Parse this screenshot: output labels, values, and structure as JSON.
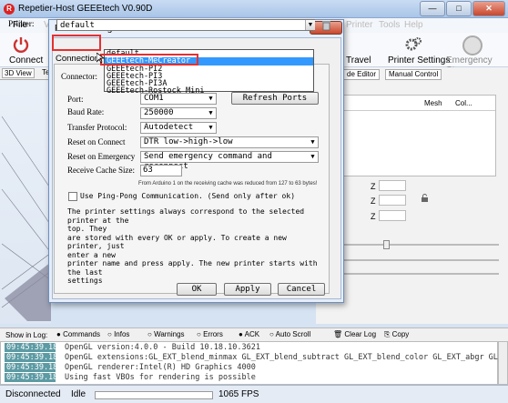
{
  "window": {
    "title": "Repetier-Host GEEEtech V0.90D",
    "icon": "R",
    "buttons": {
      "minimize": "—",
      "maximize": "□",
      "close": "✕"
    }
  },
  "menubar": [
    "File",
    "View",
    "Config",
    "Printer",
    "Tools",
    "Help"
  ],
  "toolbar": {
    "connect_label": "Connect",
    "travel_label": "Travel",
    "printer_settings_label": "Printer Settings",
    "emergency_stop_label": "Emergency Stop"
  },
  "left_tabs": [
    "3D View",
    "Te"
  ],
  "right_panel": {
    "tabs": [
      "de Editor",
      "Manual Control"
    ],
    "grid_headers": [
      "Mesh",
      "Col..."
    ],
    "z_label": "Z"
  },
  "dialog": {
    "title": "Printer Settings",
    "close": "✕",
    "printer_label": "Printer:",
    "printer_value": "default",
    "printer_options": [
      "default",
      "GEEEtech-MeCreator",
      "GEEEtech-PI2",
      "GEEEtech-PI3",
      "GEEEtech-PI3A",
      "GEEEtech-Rostock Mini"
    ],
    "selected_option_index": 1,
    "tab_connection": "Connection",
    "connector_label": "Connector:",
    "port_label": "Port:",
    "port_value": "COM1",
    "refresh_ports": "Refresh Ports",
    "baud_label": "Baud Rate:",
    "baud_value": "250000",
    "transfer_label": "Transfer Protocol:",
    "transfer_value": "Autodetect",
    "reset_connect_label": "Reset on Connect",
    "reset_connect_value": "DTR low->high->low",
    "reset_emergency_label": "Reset on Emergency",
    "reset_emergency_value": "Send emergency command and reconnect",
    "cache_label": "Receive Cache Size:",
    "cache_value": "63",
    "cache_note": "From Arduino 1 on the receiving cache was reduced from 127 to 63 bytes!",
    "ping_pong_label": "Use Ping-Pong Communication. (Send only after ok)",
    "info_lines": [
      "The printer settings always correspond to the selected printer at the",
      "top. They",
      "are stored with every OK or apply. To create a new printer, just",
      "enter a new",
      "printer name and press apply. The new printer starts with the last",
      "settings"
    ],
    "ok": "OK",
    "apply": "Apply",
    "cancel": "Cancel"
  },
  "log_toolbar": {
    "show_in_log": "Show in Log:",
    "options": [
      "Commands",
      "Infos",
      "Warnings",
      "Errors",
      "ACK",
      "Auto Scroll",
      "Clear Log",
      "Copy"
    ]
  },
  "log": [
    {
      "time": "09:45:39.185",
      "msg": "OpenGL version:4.0.0 - Build 10.18.10.3621"
    },
    {
      "time": "09:45:39.185",
      "msg": "OpenGL extensions:GL_EXT_blend_minmax GL_EXT_blend_subtract GL_EXT_blend_color GL_EXT_abgr GL_EX"
    },
    {
      "time": "09:45:39.185",
      "msg": "OpenGL renderer:Intel(R) HD Graphics 4000"
    },
    {
      "time": "09:45:39.186",
      "msg": "Using fast VBOs for rendering is possible"
    }
  ],
  "status": {
    "connection": "Disconnected",
    "state": "Idle",
    "fps": "1065 FPS"
  },
  "colors": {
    "accent": "#3399ff",
    "highlight_box": "#e53030",
    "log_time_bg": "#5d9ba4"
  }
}
